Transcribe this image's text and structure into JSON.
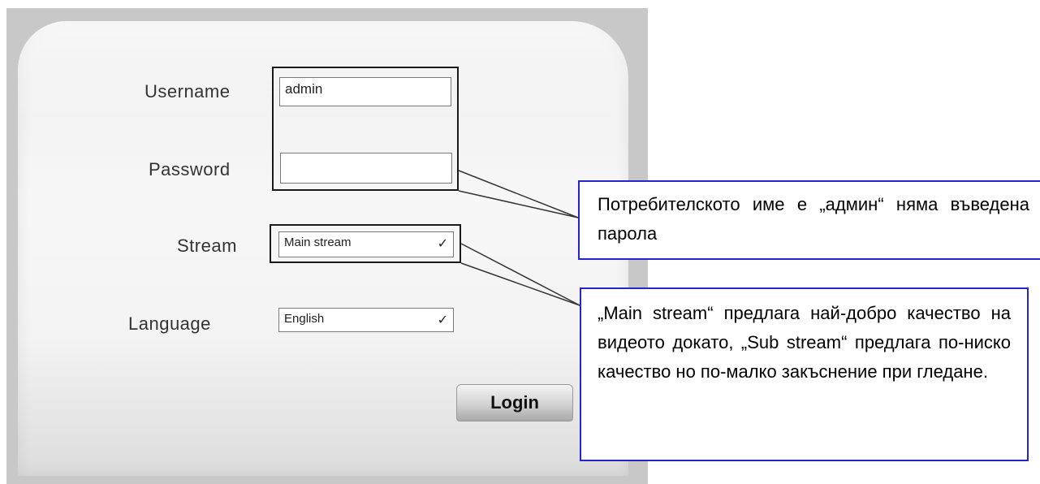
{
  "login_form": {
    "username_label": "Username",
    "username_value": "admin",
    "password_label": "Password",
    "password_value": "",
    "stream_label": "Stream",
    "stream_value": "Main stream",
    "language_label": "Language",
    "language_value": "English",
    "login_button": "Login"
  },
  "callouts": {
    "credentials_note": "Потребителското име е „админ“ няма въведена парола",
    "stream_note": "„Main stream“ предлага най-добро качество на видеото докато, „Sub stream“ предлага по-ниско качество но по-малко закъснение при гледане."
  },
  "icons": {
    "dropdown": "chevron-down-icon"
  },
  "colors": {
    "callout_border": "#2525c8",
    "panel_background": "#c8c8c8"
  }
}
